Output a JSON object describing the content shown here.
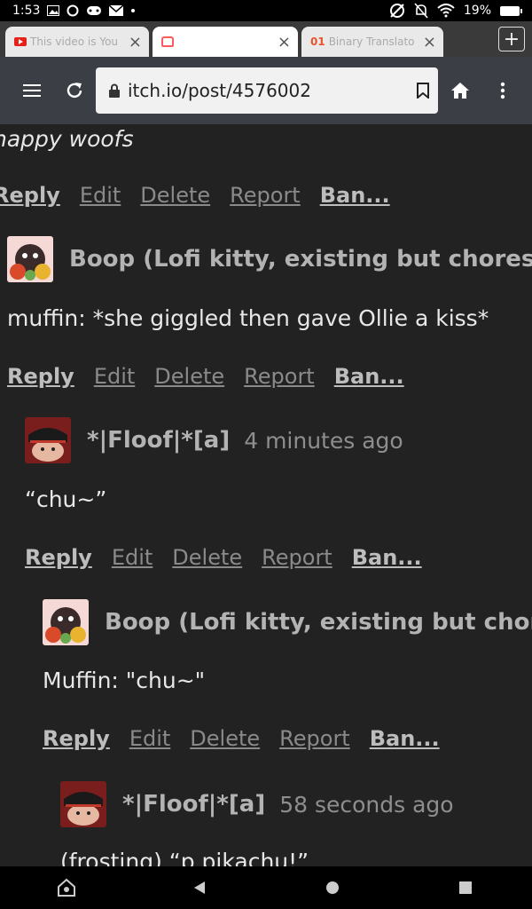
{
  "status_bar": {
    "time": "1:53",
    "battery": "19%"
  },
  "tabs": [
    {
      "title": "This video is You",
      "icon": "youtube-icon"
    },
    {
      "title": "",
      "icon": "itch-icon"
    },
    {
      "title": "Binary Translato",
      "icon": "binary-icon",
      "icon_text": "01"
    }
  ],
  "toolbar": {
    "url": "itch.io/post/4576002"
  },
  "comments": {
    "c0": {
      "text": "happy woofs",
      "actions": [
        "Reply",
        "Edit",
        "Delete",
        "Report",
        "Ban..."
      ]
    },
    "c1": {
      "author": "Boop (Lofi kitty, existing but chores)",
      "text": "muffin: *she giggled then gave Ollie a kiss*",
      "actions": [
        "Reply",
        "Edit",
        "Delete",
        "Report",
        "Ban..."
      ]
    },
    "c2": {
      "author": "*|Floof|*[a]",
      "time": "4 minutes ago",
      "text": "“chu~”",
      "actions": [
        "Reply",
        "Edit",
        "Delete",
        "Report",
        "Ban..."
      ]
    },
    "c3": {
      "author": "Boop (Lofi kitty, existing but chores)",
      "text": "Muffin: \"chu~\"",
      "actions": [
        "Reply",
        "Edit",
        "Delete",
        "Report",
        "Ban..."
      ]
    },
    "c4": {
      "author": "*|Floof|*[a]",
      "time": "58 seconds ago",
      "text": "(frosting) “p pikachu!”"
    }
  },
  "colors": {
    "page_bg": "#222222",
    "toolbar_bg": "#3b3f45",
    "text": "#e8e8e8",
    "muted": "#8a8a8a"
  }
}
